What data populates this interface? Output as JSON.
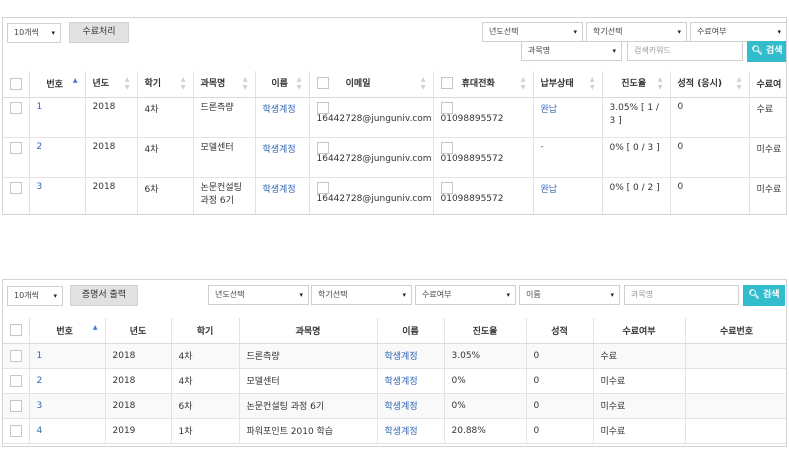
{
  "top": {
    "page_size": "10개씩",
    "process_button": "수료처리",
    "filters": {
      "year": "년도선택",
      "term": "학기선택",
      "status": "수료여부",
      "subject": "과목명"
    },
    "search": {
      "placeholder": "검색키워드",
      "button": "검색"
    },
    "columns": [
      "번호",
      "년도",
      "학기",
      "과목명",
      "이름",
      "이메일",
      "휴대전화",
      "납부상태",
      "진도율",
      "성적 (응시)",
      "수료여"
    ],
    "rows": [
      {
        "no": "1",
        "year": "2018",
        "term": "4차",
        "subject": "드론측량",
        "name": "학생계정",
        "email": "16442728@junguniv.com",
        "phone": "01098895572",
        "payment": "완납",
        "progress": "3.05% [ 1 / 3 ]",
        "grade": "0",
        "status": "수료"
      },
      {
        "no": "2",
        "year": "2018",
        "term": "4차",
        "subject": "모델센터",
        "name": "학생계정",
        "email": "16442728@junguniv.com",
        "phone": "01098895572",
        "payment": "-",
        "progress": "0% [ 0 / 3 ]",
        "grade": "0",
        "status": "미수료"
      },
      {
        "no": "3",
        "year": "2018",
        "term": "6차",
        "subject": "논문컨설팅 과정 6기",
        "name": "학생계정",
        "email": "16442728@junguniv.com",
        "phone": "01098895572",
        "payment": "완납",
        "progress": "0% [ 0 / 2 ]",
        "grade": "0",
        "status": "미수료"
      }
    ]
  },
  "bottom": {
    "page_size": "10개씩",
    "print_button": "증명서 출력",
    "filters": {
      "year": "년도선택",
      "term": "학기선택",
      "status": "수료여부",
      "name": "이름"
    },
    "search": {
      "placeholder": "과목명",
      "button": "검색"
    },
    "columns": [
      "번호",
      "년도",
      "학기",
      "과목명",
      "이름",
      "진도율",
      "성적",
      "수료여부",
      "수료번호"
    ],
    "rows": [
      {
        "no": "1",
        "year": "2018",
        "term": "4차",
        "subject": "드론측량",
        "name": "학생계정",
        "progress": "3.05%",
        "grade": "0",
        "status": "수료",
        "cert": ""
      },
      {
        "no": "2",
        "year": "2018",
        "term": "4차",
        "subject": "모델센터",
        "name": "학생계정",
        "progress": "0%",
        "grade": "0",
        "status": "미수료",
        "cert": ""
      },
      {
        "no": "3",
        "year": "2018",
        "term": "6차",
        "subject": "논문컨설팅 과정 6기",
        "name": "학생계정",
        "progress": "0%",
        "grade": "0",
        "status": "미수료",
        "cert": ""
      },
      {
        "no": "4",
        "year": "2019",
        "term": "1차",
        "subject": "파워포인트 2010 학습",
        "name": "학생계정",
        "progress": "20.88%",
        "grade": "0",
        "status": "미수료",
        "cert": ""
      }
    ]
  }
}
